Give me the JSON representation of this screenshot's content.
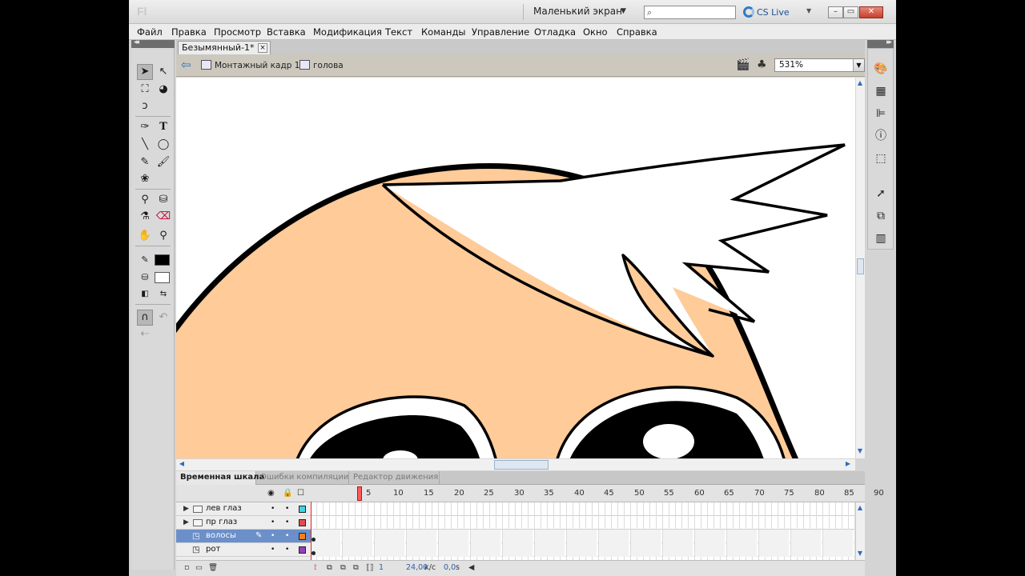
{
  "app": {
    "logo": "Fl",
    "workspace": "Маленький экран",
    "search_placeholder": "",
    "cslive": "CS Live",
    "window_buttons": {
      "minimize": "–",
      "restore": "▭",
      "close": "✕"
    }
  },
  "menu": [
    "Файл",
    "Правка",
    "Просмотр",
    "Вставка",
    "Модификация",
    "Текст",
    "Команды",
    "Управление",
    "Отладка",
    "Окно",
    "Справка"
  ],
  "document": {
    "tab_title": "Безымянный-1*",
    "close_label": "×"
  },
  "editbar": {
    "scene": "Монтажный кадр 1",
    "symbol": "голова",
    "zoom": "531%"
  },
  "colors": {
    "skin": "#fecb99",
    "stroke": "#000000",
    "selected_layer": "#6b8fc9",
    "stroke_color": "#000000",
    "fill_color": "#ffffff"
  },
  "timeline": {
    "tabs": [
      "Временная шкала",
      "Ошибки компиляции",
      "Редактор движения"
    ],
    "ruler": [
      "1",
      "5",
      "10",
      "15",
      "20",
      "25",
      "30",
      "35",
      "40",
      "45",
      "50",
      "55",
      "60",
      "65",
      "70",
      "75",
      "80",
      "85",
      "90"
    ],
    "layers": [
      {
        "name": "лев глаз",
        "kind": "folder",
        "color": "#44d3e3",
        "selected": false
      },
      {
        "name": "пр глаз",
        "kind": "folder",
        "color": "#e04c4c",
        "selected": false
      },
      {
        "name": "волосы",
        "kind": "layer",
        "color": "#f08020",
        "selected": true
      },
      {
        "name": "рот",
        "kind": "layer",
        "color": "#9a3cc0",
        "selected": false
      }
    ],
    "current_frame": "1",
    "fps": "24,00",
    "fps_unit": "к/с",
    "time": "0,0",
    "time_unit": "s"
  }
}
